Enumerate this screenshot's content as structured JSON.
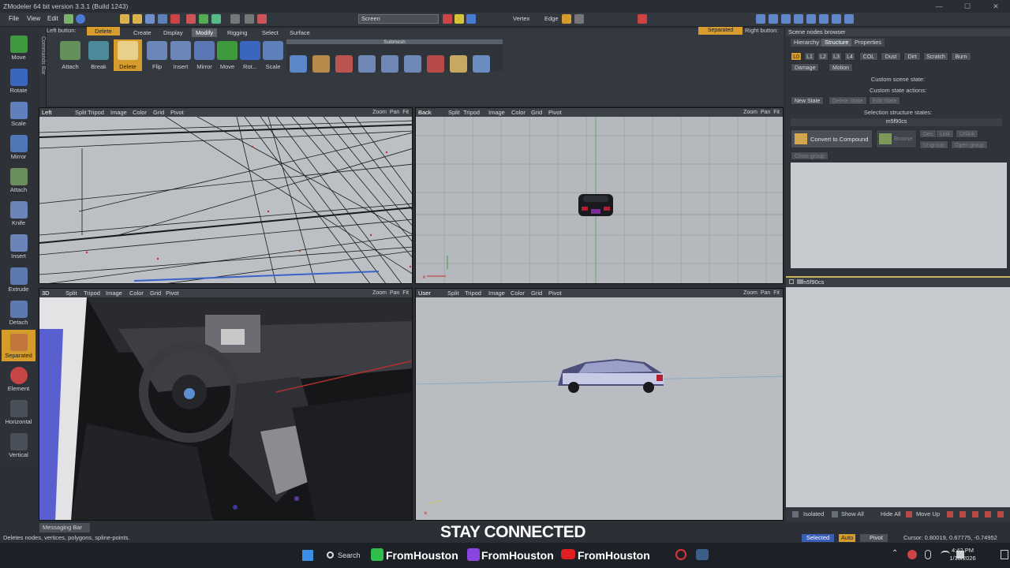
{
  "title": "ZModeler 64 bit version 3.3.1 (Build 1243)",
  "menu": [
    "File",
    "View",
    "Edit"
  ],
  "toolbar": {
    "screen_select": "Screen",
    "vertex_label": "Vertex",
    "edge_label": "Edge"
  },
  "left_tools": [
    "Move",
    "Rotate",
    "Scale",
    "Mirror",
    "Attach",
    "Knife",
    "Insert",
    "Extrude",
    "Detach",
    "Separated",
    "Element",
    "Horizontal",
    "Vertical"
  ],
  "commands_bar_label": "Commands Bar",
  "ribbon": {
    "left_button_label": "Left button:",
    "left_button_value": "Delete",
    "tabs": [
      "Create",
      "Display",
      "Modify",
      "Rigging",
      "Select",
      "Surface"
    ],
    "active_tab": "Modify",
    "buttons": [
      "Attach",
      "Break",
      "Delete",
      "Flip",
      "Insert",
      "Mirror",
      "Move",
      "Rot...",
      "Scale"
    ],
    "submesh_label": "Submesh",
    "separated_label": "Separated",
    "right_button_label": "Right button:"
  },
  "viewports": [
    {
      "name": "Left",
      "controls": [
        "Split",
        "Tripod",
        "Image",
        "Color",
        "Grid",
        "Pivot"
      ],
      "nav": [
        "Zoom",
        "Pan",
        "Fit"
      ]
    },
    {
      "name": "Back",
      "controls": [
        "Split",
        "Tripod",
        "Image",
        "Color",
        "Grid",
        "Pivot"
      ],
      "nav": [
        "Zoom",
        "Pan",
        "Fit"
      ]
    },
    {
      "name": "3D",
      "controls": [
        "Split",
        "Tripod",
        "Image",
        "Color",
        "Grid",
        "Pivot"
      ],
      "nav": [
        "Zoom",
        "Pan",
        "Fit"
      ]
    },
    {
      "name": "User",
      "controls": [
        "Split",
        "Tripod",
        "Image",
        "Color",
        "Grid",
        "Pivot"
      ],
      "nav": [
        "Zoom",
        "Pan",
        "Fit"
      ]
    }
  ],
  "right_panel": {
    "header": "Scene nodes browser",
    "tabs": [
      "Hierarchy",
      "Structure",
      "Properties"
    ],
    "active_tab": "Structure",
    "levels": [
      "L0",
      "L1",
      "L2",
      "L3",
      "L4",
      "COL",
      "Dust",
      "Dirt",
      "Scratch",
      "Burn"
    ],
    "dropdowns": [
      "Damage",
      "Motion"
    ],
    "custom_scene_state": "Custom scene state:",
    "custom_state_actions": "Custom state actions:",
    "new_state": "New State",
    "delete_state": "Delete State",
    "edit_state": "Edit State",
    "selection_structure_states": "Selection structure states:",
    "selected_node": "m5f90cs",
    "convert_to_compound": "Convert to Compound",
    "browse": "Browse",
    "side_buttons": [
      "Dec",
      "Link",
      "Unlink",
      "Ungroup",
      "Open group"
    ],
    "close_group": "Close group"
  },
  "scene_browser": {
    "node": "m5f90cs",
    "footer": [
      "Isolated",
      "Show All",
      "Hide All",
      "Move Up"
    ]
  },
  "messaging_bar": "Messaging Bar",
  "status": {
    "hint": "Deletes nodes, vertices, polygons, spline-points.",
    "selected": "Selected",
    "auto": "Auto",
    "pivot": "Pivot",
    "cursor": "Cursor: 0.80019, 0.67775, -0.74952"
  },
  "overlay_text": "STAY CONNECTED",
  "taskbar": {
    "search": "Search",
    "channels": [
      "FromHouston",
      "FromHouston",
      "FromHouston"
    ],
    "time": "4:42 PM",
    "date": "1/10/2026"
  },
  "colors": {
    "accent": "#d59c2b",
    "panel": "#30343a",
    "viewport": "#b8bcc1"
  }
}
